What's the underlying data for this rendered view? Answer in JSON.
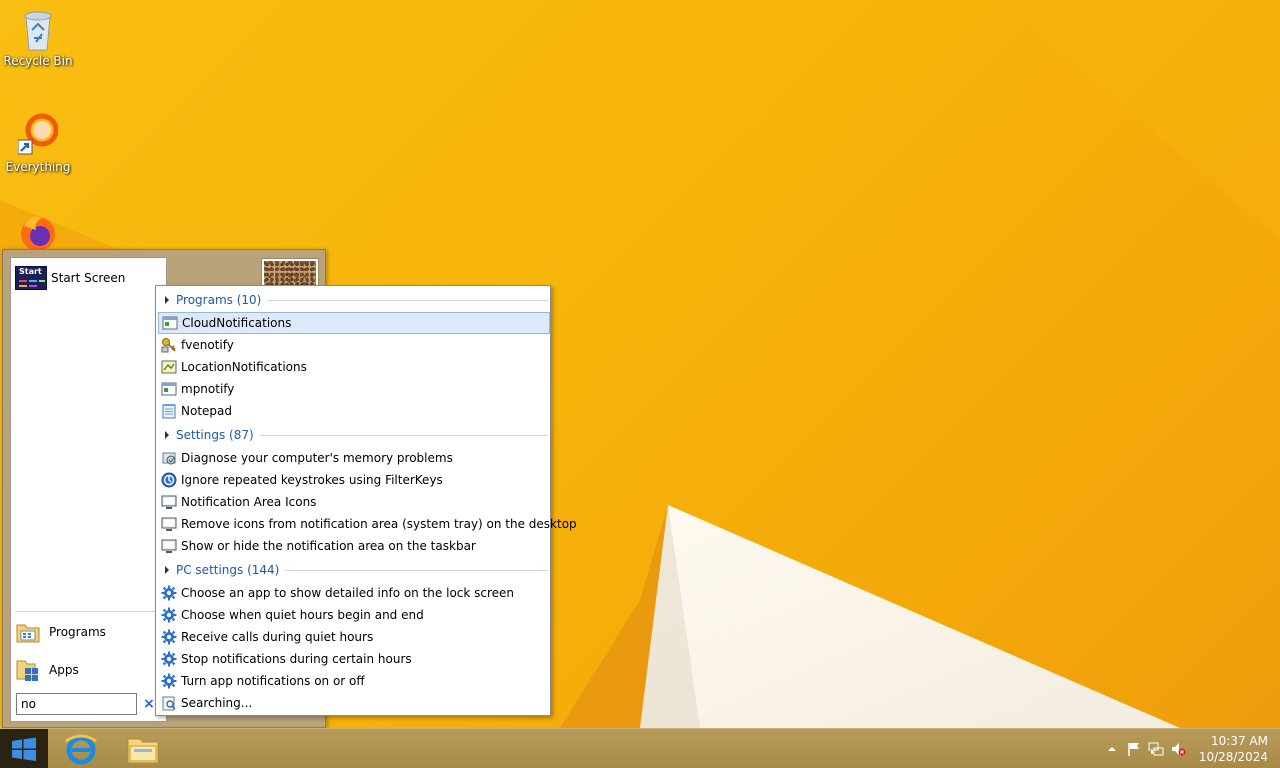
{
  "desktop": {
    "icons": [
      {
        "label": "Recycle Bin",
        "icon": "recycle-bin-icon"
      },
      {
        "label": "Everything",
        "icon": "everything-search-icon"
      },
      {
        "label": "",
        "icon": "firefox-icon"
      }
    ]
  },
  "start_menu": {
    "start_screen_label": "Start Screen",
    "start_screen_icon_text": "Start",
    "programs_label": "Programs",
    "apps_label": "Apps",
    "search_value": "no",
    "clear_symbol": "×"
  },
  "results": {
    "groups": [
      {
        "title": "Programs (10)",
        "items": [
          {
            "label": "CloudNotifications",
            "icon": "window-app-icon",
            "selected": true
          },
          {
            "label": "fvenotify",
            "icon": "keys-icon"
          },
          {
            "label": "LocationNotifications",
            "icon": "location-app-icon"
          },
          {
            "label": "mpnotify",
            "icon": "window-app-icon"
          },
          {
            "label": "Notepad",
            "icon": "notepad-icon"
          }
        ]
      },
      {
        "title": "Settings (87)",
        "items": [
          {
            "label": "Diagnose your computer's memory problems",
            "icon": "memory-diagnostic-icon"
          },
          {
            "label": "Ignore repeated keystrokes using FilterKeys",
            "icon": "ease-of-access-icon"
          },
          {
            "label": "Notification Area Icons",
            "icon": "monitor-settings-icon"
          },
          {
            "label": "Remove icons from notification area (system tray) on the desktop",
            "icon": "monitor-settings-icon"
          },
          {
            "label": "Show or hide the notification area on the taskbar",
            "icon": "monitor-settings-icon"
          }
        ]
      },
      {
        "title": "PC settings (144)",
        "items": [
          {
            "label": "Choose an app to show detailed info on the lock screen",
            "icon": "gear-icon"
          },
          {
            "label": "Choose when quiet hours begin and end",
            "icon": "gear-icon"
          },
          {
            "label": "Receive calls during quiet hours",
            "icon": "gear-icon"
          },
          {
            "label": "Stop notifications during certain hours",
            "icon": "gear-icon"
          },
          {
            "label": "Turn app notifications on or off",
            "icon": "gear-icon"
          }
        ]
      }
    ],
    "searching_label": "Searching..."
  },
  "taskbar": {
    "apps": [
      "internet-explorer-icon",
      "file-explorer-icon"
    ],
    "tray_icons": [
      "show-hidden-icons-chevron",
      "action-center-flag-icon",
      "network-icon",
      "volume-muted-icon"
    ],
    "time": "10:37 AM",
    "date": "10/28/2024"
  },
  "colors": {
    "accent": "#1e5aa8",
    "wallpaper": "#f7b30a",
    "selection": "#dce9f8"
  }
}
